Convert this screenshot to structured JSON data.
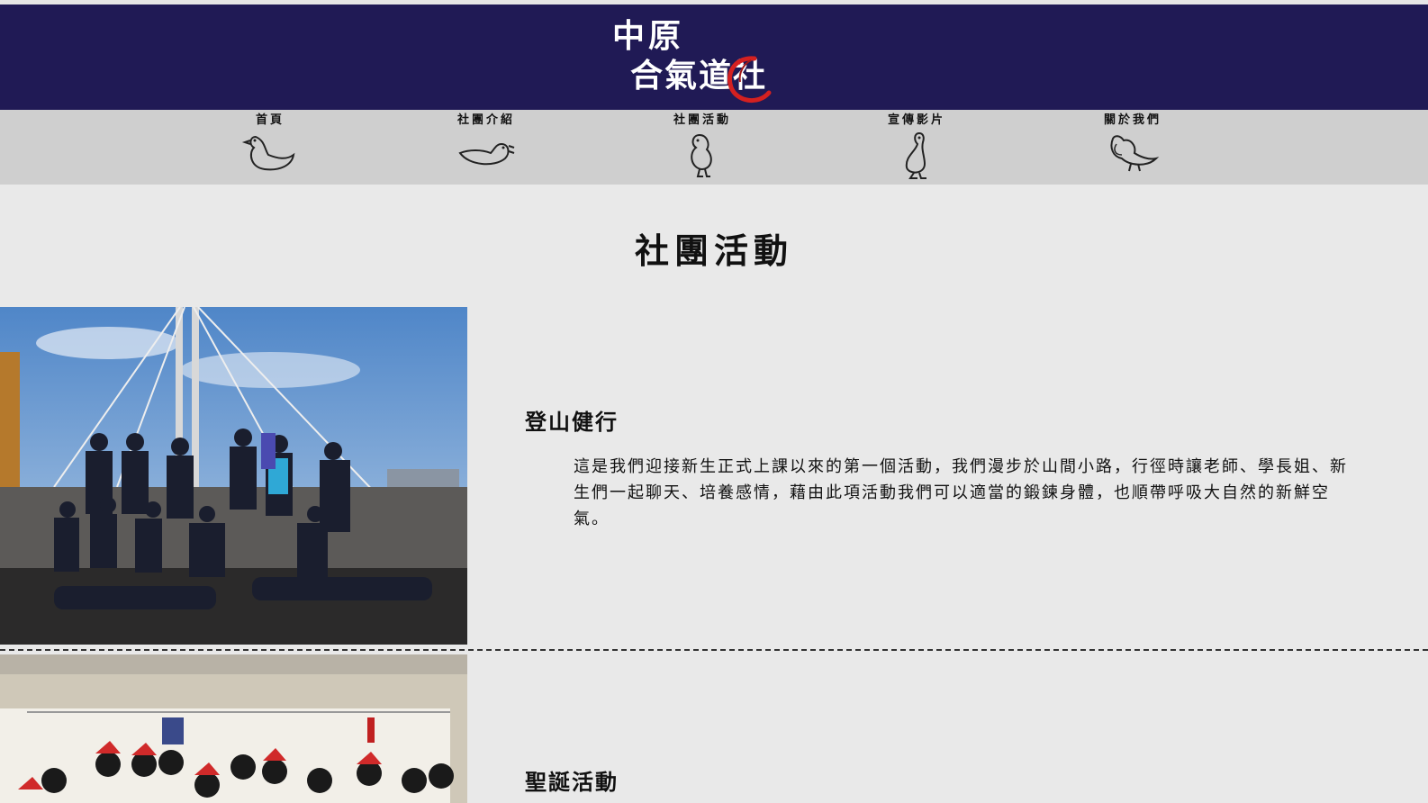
{
  "header": {
    "logo_line1": "中原",
    "logo_line2": "合氣道社",
    "logo_accent_color": "#d42020",
    "background_color": "#201a55"
  },
  "nav": {
    "items": [
      {
        "label": "首頁",
        "icon": "duck-sitting-icon"
      },
      {
        "label": "社團介紹",
        "icon": "duck-lying-icon"
      },
      {
        "label": "社團活動",
        "icon": "duck-standing-icon"
      },
      {
        "label": "宣傳影片",
        "icon": "duck-tall-icon"
      },
      {
        "label": "關於我們",
        "icon": "duck-flapping-icon"
      }
    ]
  },
  "page": {
    "title": "社團活動"
  },
  "activities": [
    {
      "title": "登山健行",
      "description": "這是我們迎接新生正式上課以來的第一個活動，我們漫步於山間小路，行徑時讓老師、學長姐、新生們一起聊天、培養感情，藉由此項活動我們可以適當的鍛鍊身體，也順帶呼吸大自然的新鮮空氣。",
      "photo": "group-photo-bridge"
    },
    {
      "title": "聖誕活動",
      "description": "",
      "photo": "group-photo-christmas"
    }
  ]
}
